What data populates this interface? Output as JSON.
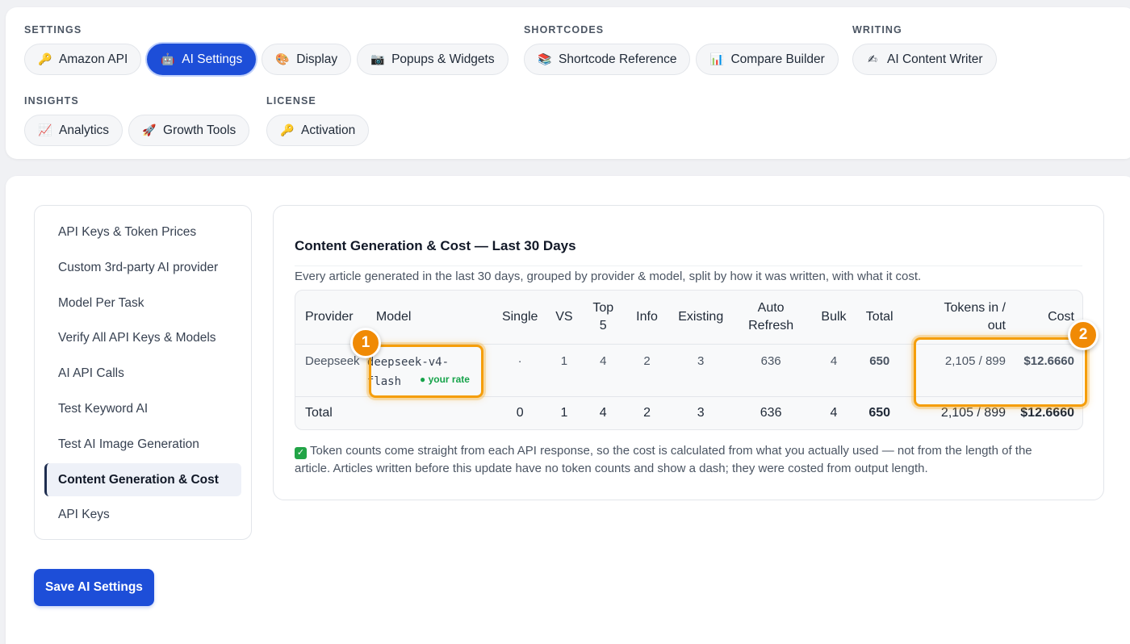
{
  "nav": {
    "groups": [
      {
        "label": "SETTINGS",
        "items": [
          {
            "label": "Amazon API",
            "icon": "key-icon",
            "glyph": "🔑"
          },
          {
            "label": "AI Settings",
            "icon": "robot-icon",
            "glyph": "🤖",
            "active": true
          },
          {
            "label": "Display",
            "icon": "palette-icon",
            "glyph": "🎨"
          },
          {
            "label": "Popups & Widgets",
            "icon": "camera-icon",
            "glyph": "📷"
          }
        ]
      },
      {
        "label": "SHORTCODES",
        "items": [
          {
            "label": "Shortcode Reference",
            "icon": "books-icon",
            "glyph": "📚"
          },
          {
            "label": "Compare Builder",
            "icon": "bar-chart-icon",
            "glyph": "📊"
          }
        ]
      },
      {
        "label": "WRITING",
        "items": [
          {
            "label": "AI Content Writer",
            "icon": "writing-hand-icon",
            "glyph": "✍"
          }
        ]
      },
      {
        "label": "INSIGHTS",
        "items": [
          {
            "label": "Analytics",
            "icon": "trend-up-icon",
            "glyph": "📈"
          },
          {
            "label": "Growth Tools",
            "icon": "rocket-icon",
            "glyph": "🚀"
          }
        ]
      },
      {
        "label": "LICENSE",
        "items": [
          {
            "label": "Activation",
            "icon": "key-icon",
            "glyph": "🔑"
          }
        ]
      }
    ]
  },
  "sidebar": {
    "items": [
      {
        "label": "API Keys & Token Prices"
      },
      {
        "label": "Custom 3rd-party AI provider"
      },
      {
        "label": "Model Per Task"
      },
      {
        "label": "Verify All API Keys & Models"
      },
      {
        "label": "AI API Calls"
      },
      {
        "label": "Test Keyword AI"
      },
      {
        "label": "Test AI Image Generation"
      },
      {
        "label": "Content Generation & Cost",
        "active": true
      },
      {
        "label": "API Keys"
      }
    ],
    "save_label": "Save AI Settings"
  },
  "content": {
    "title": "Content Generation & Cost — Last 30 Days",
    "description": "Every article generated in the last 30 days, grouped by provider & model, split by how it was written, with what it cost.",
    "table": {
      "headers": {
        "provider": "Provider",
        "model": "Model",
        "single": "Single",
        "vs": "VS",
        "top5": "Top 5",
        "info": "Info",
        "existing": "Existing",
        "auto_refresh": "Auto Refresh",
        "bulk": "Bulk",
        "total": "Total",
        "tokens": "Tokens in / out",
        "cost": "Cost"
      },
      "row": {
        "provider": "Deepseek",
        "model": "deepseek-v4-flash",
        "rate_badge": "● your rate",
        "single": "·",
        "vs": "1",
        "top5": "4",
        "info": "2",
        "existing": "3",
        "auto_refresh": "636",
        "bulk": "4",
        "total": "650",
        "tokens": "2,105 / 899",
        "cost": "$12.6660"
      },
      "totals": {
        "label": "Total",
        "single": "0",
        "vs": "1",
        "top5": "4",
        "info": "2",
        "existing": "3",
        "auto_refresh": "636",
        "bulk": "4",
        "total": "650",
        "tokens": "2,105 / 899",
        "cost": "$12.6660"
      }
    },
    "note": "Token counts come straight from each API response, so the cost is calculated from what you actually used — not from the length of the article. Articles written before this update have no token counts and show a dash; they were costed from output length.",
    "note_icon": "check-icon",
    "note_glyph": "✓"
  },
  "annotations": [
    {
      "label": "1"
    },
    {
      "label": "2"
    }
  ],
  "colors": {
    "accent": "#1d4ed8",
    "highlight": "#f59e0b",
    "marker": "#f08a05",
    "success": "#16a34a"
  }
}
